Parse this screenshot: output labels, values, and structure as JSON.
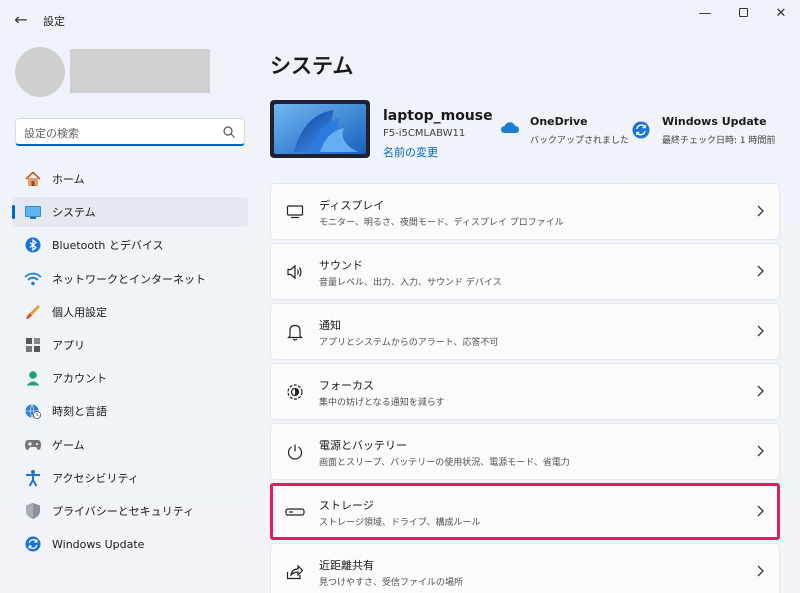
{
  "titlebar": {
    "title": "設定",
    "back": "←",
    "minimize": "—",
    "close": "✕"
  },
  "search": {
    "placeholder": "設定の検索"
  },
  "nav": [
    {
      "label": "ホーム",
      "icon": "home-icon",
      "active": false
    },
    {
      "label": "システム",
      "icon": "system-icon",
      "active": true
    },
    {
      "label": "Bluetooth とデバイス",
      "icon": "bluetooth-icon",
      "active": false
    },
    {
      "label": "ネットワークとインターネット",
      "icon": "wifi-icon",
      "active": false
    },
    {
      "label": "個人用設定",
      "icon": "brush-icon",
      "active": false
    },
    {
      "label": "アプリ",
      "icon": "apps-icon",
      "active": false
    },
    {
      "label": "アカウント",
      "icon": "account-icon",
      "active": false
    },
    {
      "label": "時刻と言語",
      "icon": "globe-clock-icon",
      "active": false
    },
    {
      "label": "ゲーム",
      "icon": "gamepad-icon",
      "active": false
    },
    {
      "label": "アクセシビリティ",
      "icon": "accessibility-icon",
      "active": false
    },
    {
      "label": "プライバシーとセキュリティ",
      "icon": "shield-icon",
      "active": false
    },
    {
      "label": "Windows Update",
      "icon": "update-icon",
      "active": false
    }
  ],
  "main": {
    "title": "システム",
    "device": {
      "name": "laptop_mouse",
      "model": "F5-i5CMLABW11",
      "rename": "名前の変更"
    },
    "onedrive": {
      "title": "OneDrive",
      "subtitle": "バックアップされました"
    },
    "windows_update": {
      "title": "Windows Update",
      "subtitle": "最終チェック日時: 1 時間前"
    },
    "cards": [
      {
        "title": "ディスプレイ",
        "subtitle": "モニター、明るさ、夜間モード、ディスプレイ プロファイル",
        "icon": "display-icon",
        "highlighted": false
      },
      {
        "title": "サウンド",
        "subtitle": "音量レベル、出力、入力、サウンド デバイス",
        "icon": "speaker-icon",
        "highlighted": false
      },
      {
        "title": "通知",
        "subtitle": "アプリとシステムからのアラート、応答不可",
        "icon": "bell-icon",
        "highlighted": false
      },
      {
        "title": "フォーカス",
        "subtitle": "集中の妨げとなる通知を減らす",
        "icon": "focus-icon",
        "highlighted": false
      },
      {
        "title": "電源とバッテリー",
        "subtitle": "画面とスリープ、バッテリーの使用状況、電源モード、省電力",
        "icon": "power-icon",
        "highlighted": false
      },
      {
        "title": "ストレージ",
        "subtitle": "ストレージ領域、ドライブ、構成ルール",
        "icon": "storage-icon",
        "highlighted": true
      },
      {
        "title": "近距離共有",
        "subtitle": "見つけやすさ、受信ファイルの場所",
        "icon": "share-icon",
        "highlighted": false
      }
    ]
  },
  "colors": {
    "accent": "#0067c0",
    "highlight": "#e6195f"
  }
}
